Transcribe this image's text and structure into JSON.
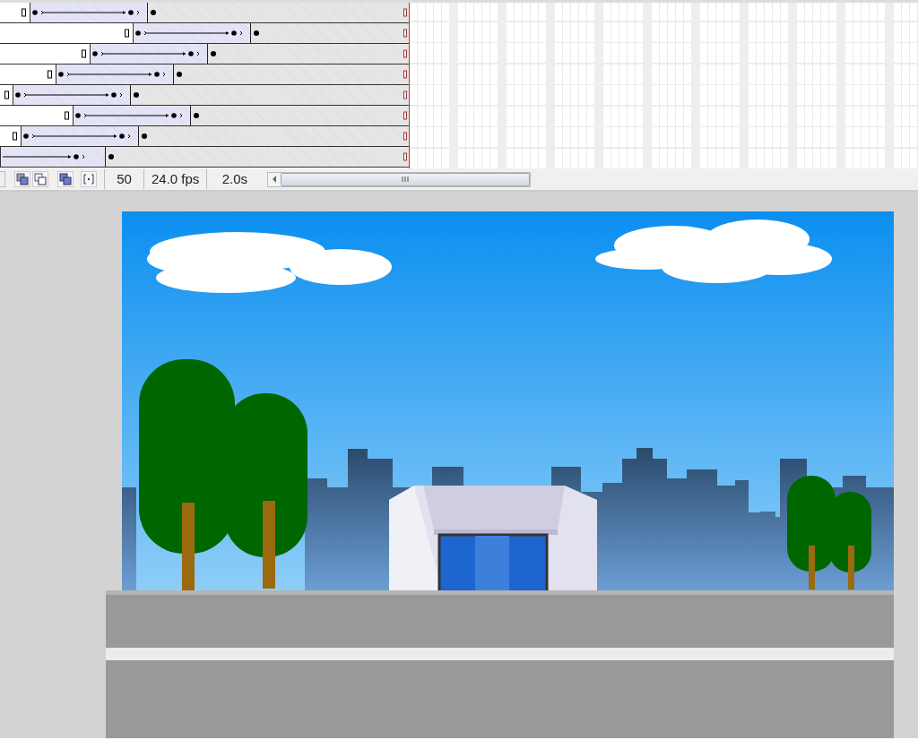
{
  "timeline": {
    "layers": [
      {
        "kind": "full",
        "lead": {
          "level": 0.073
        }
      },
      {
        "kind": "full",
        "lead": {
          "level": 0.325
        }
      },
      {
        "kind": "full",
        "lead": {
          "level": 0.219
        }
      },
      {
        "kind": "full",
        "lead": {
          "level": 0.135
        }
      },
      {
        "kind": "full",
        "lead": {
          "level": 0.031
        }
      },
      {
        "kind": "full",
        "lead": {
          "level": 0.177
        }
      },
      {
        "kind": "full",
        "lead": {
          "level": 0.051
        }
      },
      {
        "kind": "clipped",
        "lead": {
          "level": 0
        }
      }
    ]
  },
  "status_bar": {
    "current_frame": "50",
    "frame_rate": "24.0 fps",
    "elapsed_time": "2.0s"
  }
}
